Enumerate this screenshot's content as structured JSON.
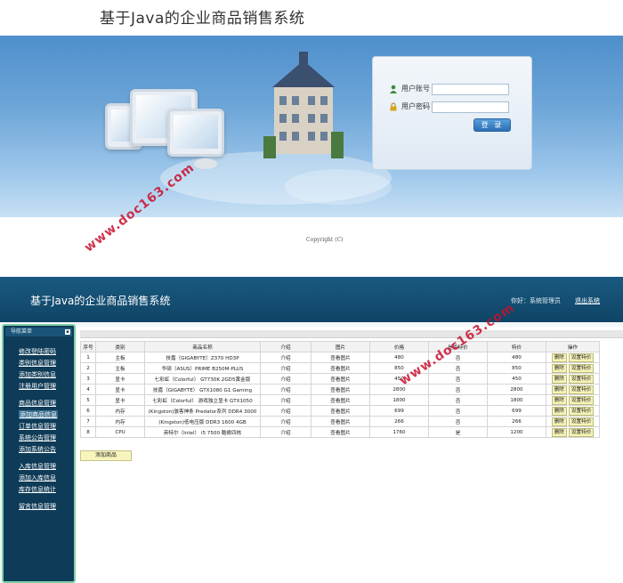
{
  "login": {
    "title": "基于Java的企业商品销售系统",
    "username_label": "用户账号",
    "password_label": "用户密码",
    "submit_label": "登 录",
    "copyright": "Copyright (C)"
  },
  "admin": {
    "title": "基于Java的企业商品销售系统",
    "greeting": "你好：系统管理员",
    "logout": "退出系统",
    "sidebar": {
      "title": "导航菜单",
      "collapse": "▪",
      "groups": [
        [
          "修改登陆密码",
          "类别信息管理",
          "添加类别信息",
          "注册用户管理"
        ],
        [
          "商品信息管理",
          "添加商品信息",
          "订单信息管理",
          "系统公告管理",
          "添加系统公告"
        ],
        [
          "入库信息管理",
          "添加入库信息",
          "库存信息统计"
        ],
        [
          "留言信息管理"
        ]
      ]
    },
    "table": {
      "headers": [
        "序号",
        "类别",
        "商品名称",
        "介绍",
        "图片",
        "价格",
        "是否特价",
        "特价",
        "操作"
      ],
      "rows": [
        [
          "1",
          "主板",
          "技嘉（GIGABYTE）Z370 HD3P",
          "介绍",
          "查看图片",
          "480",
          "否",
          "480"
        ],
        [
          "2",
          "主板",
          "华硕（ASUS）PRIME B250M-PLUS",
          "介绍",
          "查看图片",
          "850",
          "否",
          "850"
        ],
        [
          "3",
          "显卡",
          "七彩虹（Colorful） GT730K 2GD5黄金版",
          "介绍",
          "查看图片",
          "450",
          "否",
          "450"
        ],
        [
          "4",
          "显卡",
          "技嘉（GIGABYTE） GTX1080 G1 Gaming",
          "介绍",
          "查看图片",
          "2800",
          "否",
          "2800"
        ],
        [
          "5",
          "显卡",
          "七彩虹（Colorful） 游戏独立显卡 GTX1050",
          "介绍",
          "查看图片",
          "1800",
          "否",
          "1800"
        ],
        [
          "6",
          "内存",
          "(Kingston)骇客神条 Predator系列 DDR4 3000",
          "介绍",
          "查看图片",
          "699",
          "否",
          "699"
        ],
        [
          "7",
          "内存",
          "(Kingston)低电压版 DDR3 1600 4GB",
          "介绍",
          "查看图片",
          "266",
          "否",
          "266"
        ],
        [
          "8",
          "CPU",
          "英特尔（Intel） i5 7500 酷睿四核",
          "介绍",
          "查看图片",
          "1760",
          "是",
          "1200"
        ]
      ],
      "delete_label": "删除",
      "special_label": "设置特价"
    },
    "add_button": "添加商品"
  },
  "watermark": "www.doc163.com",
  "colors": {
    "header": "#0f4466",
    "sidebar": "#0e3b57",
    "sidebar_border": "#7ed0a6",
    "button_yellow": "#f6f3b8",
    "watermark": "#c8102e"
  }
}
